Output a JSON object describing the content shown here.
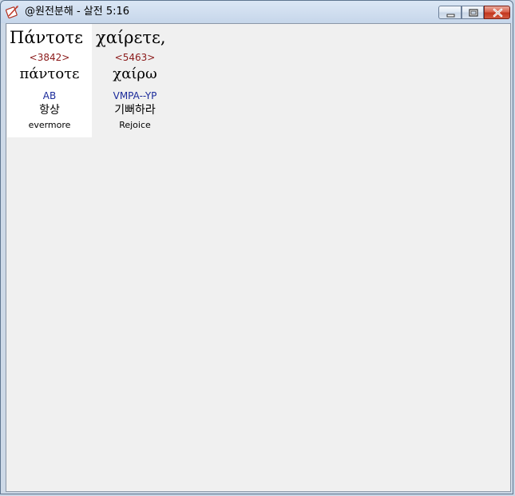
{
  "window": {
    "title": "@원전분해 - 살전 5:16",
    "icon": "app-quill-icon"
  },
  "controls": {
    "minimize_icon": "minimize-icon",
    "maximize_icon": "maximize-icon",
    "close_icon": "close-icon"
  },
  "words": [
    {
      "greek": "Πάντοτε",
      "strongs": "<3842>",
      "lemma": "πάντοτε",
      "morph": "AB",
      "korean": "항상",
      "english": "evermore"
    },
    {
      "greek": "χαίρετε,",
      "strongs": "<5463>",
      "lemma": "χαίρω",
      "morph": "VMPA--YP",
      "korean": "기뻐하라",
      "english": "Rejoice"
    }
  ],
  "colors": {
    "strongs": "#8b1a1a",
    "morph": "#1a2a9a",
    "selected_cell": "#ffffff",
    "client_bg": "#f0f0f0"
  }
}
